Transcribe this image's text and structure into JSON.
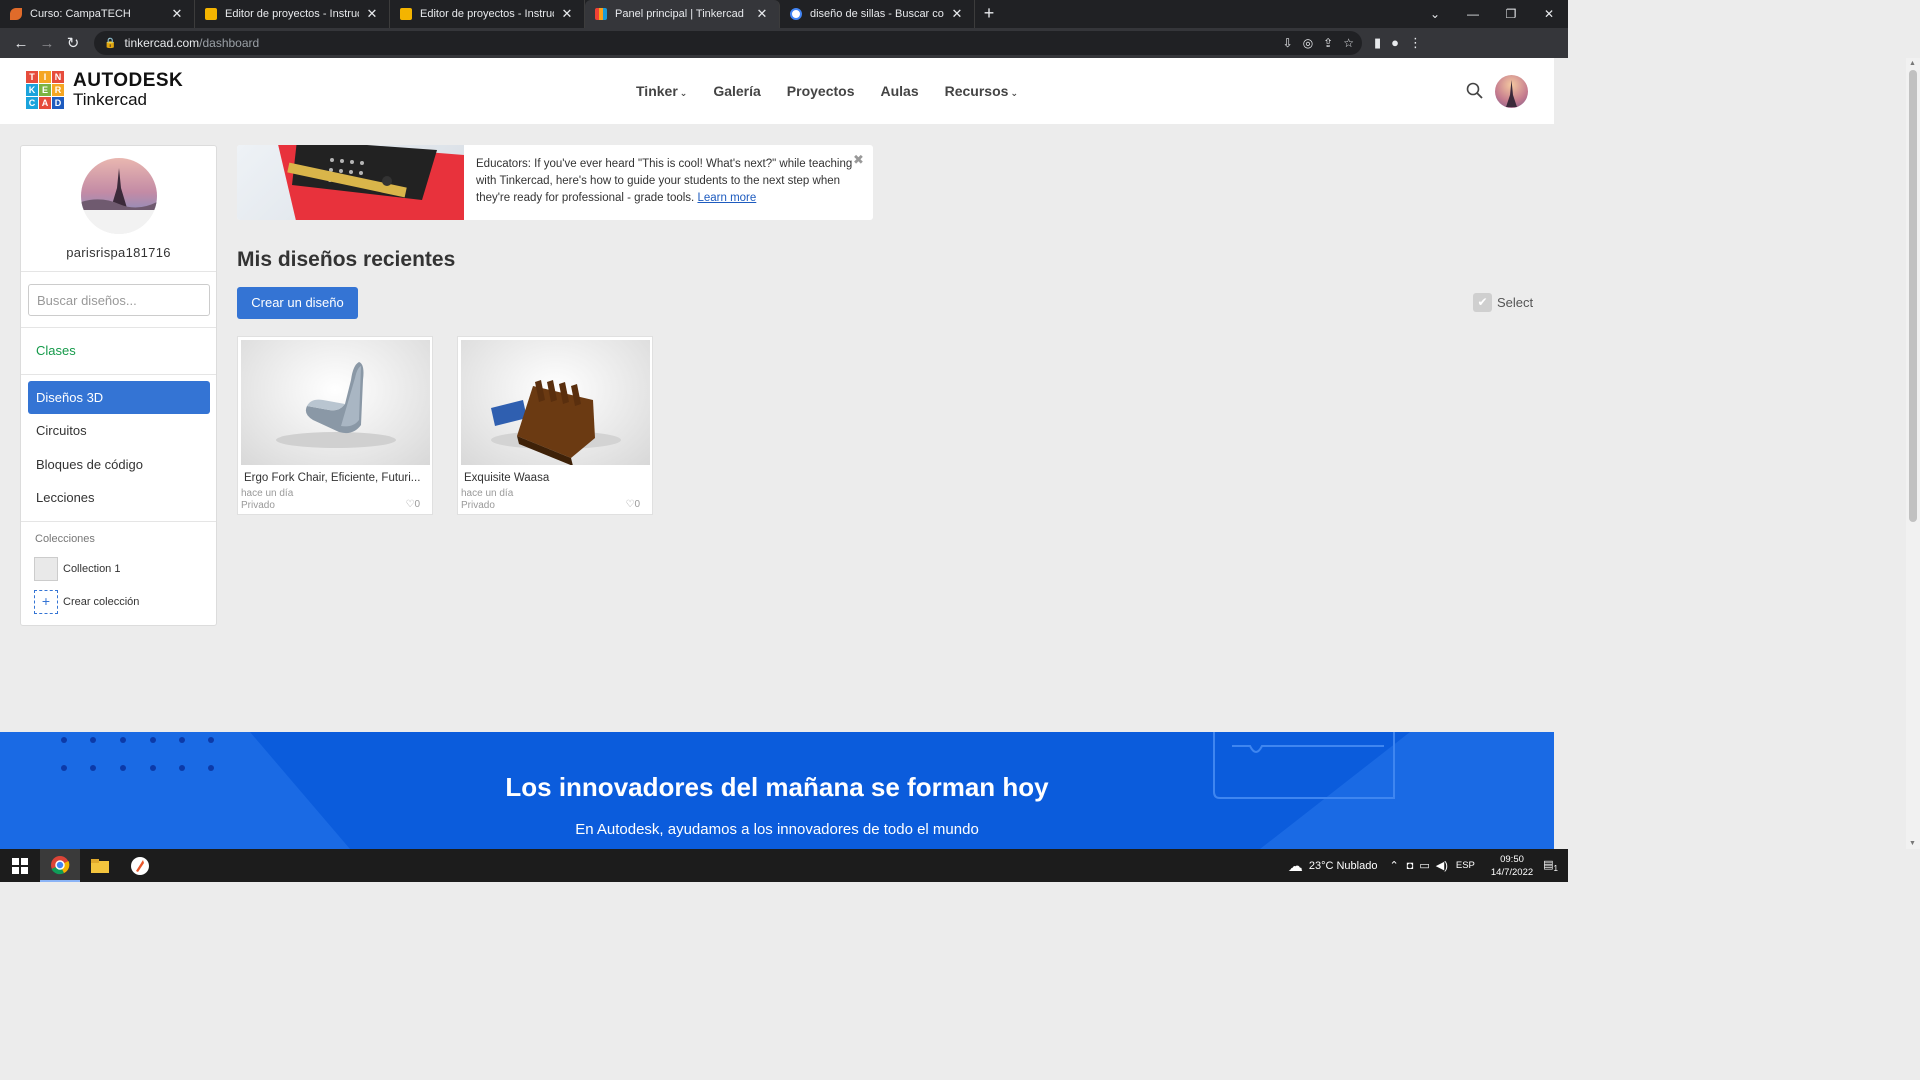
{
  "browser": {
    "tabs": [
      {
        "label": "Curso: CampaTECH",
        "favicon_color": "#e06b2a",
        "active": false
      },
      {
        "label": "Editor de proyectos - Instructable",
        "favicon_color": "#f4b400",
        "active": false
      },
      {
        "label": "Editor de proyectos - Instructable",
        "favicon_color": "#f4b400",
        "active": false
      },
      {
        "label": "Panel principal | Tinkercad",
        "favicon_color": "#ef4135",
        "active": true
      },
      {
        "label": "diseño de sillas - Buscar con Goo",
        "favicon_color": "#4285f4",
        "active": false
      }
    ],
    "url_host": "tinkercad.com",
    "url_path": "/dashboard"
  },
  "header": {
    "logo_letters": [
      "T",
      "I",
      "N",
      "K",
      "E",
      "R",
      "C",
      "A",
      "D"
    ],
    "logo_line1": "AUTODESK",
    "logo_line2": "Tinkercad",
    "nav": [
      {
        "label": "Tinker",
        "caret": true
      },
      {
        "label": "Galería",
        "caret": false
      },
      {
        "label": "Proyectos",
        "caret": false
      },
      {
        "label": "Aulas",
        "caret": false
      },
      {
        "label": "Recursos",
        "caret": true
      }
    ]
  },
  "sidebar": {
    "username": "parisrispa181716",
    "search_placeholder": "Buscar diseños...",
    "clases": "Clases",
    "active_item": "Diseños 3D",
    "items": [
      "Circuitos",
      "Bloques de código",
      "Lecciones"
    ],
    "collections_title": "Colecciones",
    "collection_1": "Collection 1",
    "create_collection": "Crear colección"
  },
  "banner": {
    "text": "Educators: If you've ever heard \"This is cool! What's next?\" while teaching with Tinkercad, here's how to guide your students to the next step when they're ready for professional - grade tools.",
    "link": "Learn more"
  },
  "main": {
    "title": "Mis diseños recientes",
    "create_button": "Crear un diseño",
    "select_label": "Select",
    "designs": [
      {
        "title": "Ergo Fork Chair, Eficiente, Futuri...",
        "date": "hace un día",
        "visibility": "Privado",
        "likes": "0"
      },
      {
        "title": "Exquisite Waasa",
        "date": "hace un día",
        "visibility": "Privado",
        "likes": "0"
      }
    ]
  },
  "hero": {
    "title": "Los innovadores del mañana se forman hoy",
    "subtitle": "En Autodesk, ayudamos a los innovadores de todo el mundo"
  },
  "taskbar": {
    "weather": "23°C  Nublado",
    "lang": "ESP",
    "time": "09:50",
    "date": "14/7/2022",
    "notif": "1"
  },
  "colors": {
    "accent": "#3474d4",
    "hero_bg": "#0b5cdc",
    "clases_green": "#159a4a"
  }
}
